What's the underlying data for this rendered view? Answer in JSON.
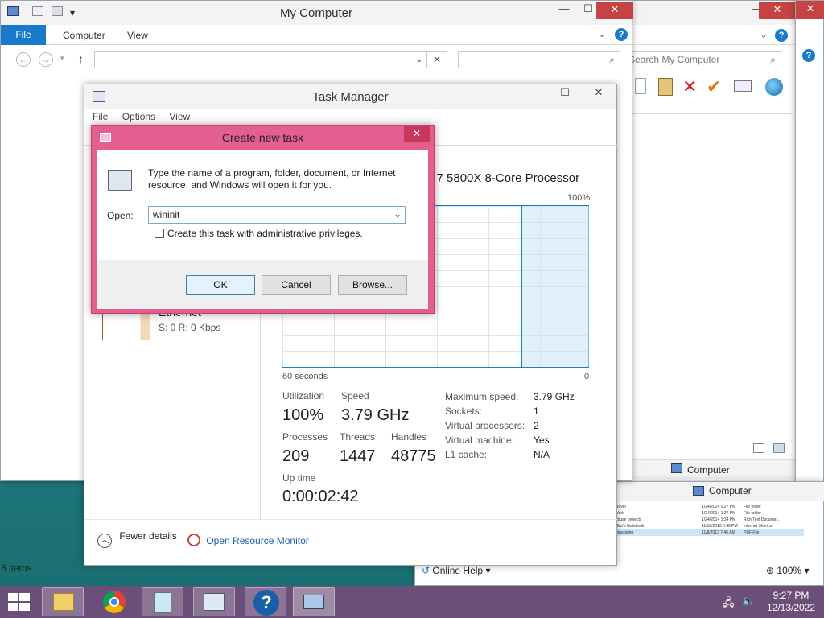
{
  "explorer": {
    "title": "My Computer",
    "tabs": [
      "File",
      "Computer",
      "View"
    ],
    "search_placeholder": "",
    "status_items": "8 items"
  },
  "explorer_back": {
    "search_placeholder": "Search My Computer",
    "status_left": "Computer",
    "status_left2": "Computer",
    "help_label": "Online Help",
    "zoom": "100%"
  },
  "file_list": {
    "rows": [
      {
        "name": "Travel",
        "date": "1/24/2014 1:27 PM",
        "type": "File folder"
      },
      {
        "name": "Work",
        "date": "1/24/2014 1:27 PM",
        "type": "File folder"
      },
      {
        "name": "House projects",
        "date": "1/24/2014 1:34 PM",
        "type": "Rich Text Docume..."
      },
      {
        "name": "Mitzi's Notebook",
        "date": "11/18/2013 5:46 PM",
        "type": "Internet Shortcut"
      },
      {
        "name": "Newsletter",
        "date": "11/8/2013 7:46 AM",
        "type": "PDF File"
      }
    ]
  },
  "task_manager": {
    "title": "Task Manager",
    "menu": [
      "File",
      "Options",
      "View"
    ],
    "processor": "n 7 5800X 8-Core Processor",
    "graph_max": "100%",
    "graph_left": "60 seconds",
    "graph_right": "0",
    "ethernet_label": "Ethernet",
    "ethernet_value": "S: 0 R: 0 Kbps",
    "utilization_label": "Utilization",
    "utilization": "100%",
    "speed_label": "Speed",
    "speed": "3.79 GHz",
    "processes_label": "Processes",
    "processes": "209",
    "threads_label": "Threads",
    "threads": "1447",
    "handles_label": "Handles",
    "handles": "48775",
    "uptime_label": "Up time",
    "uptime": "0:00:02:42",
    "details": [
      {
        "k": "Maximum speed:",
        "v": "3.79 GHz"
      },
      {
        "k": "Sockets:",
        "v": "1"
      },
      {
        "k": "Virtual processors:",
        "v": "2"
      },
      {
        "k": "Virtual machine:",
        "v": "Yes"
      },
      {
        "k": "L1 cache:",
        "v": "N/A"
      }
    ],
    "fewer_details": "Fewer details",
    "resource_monitor": "Open Resource Monitor"
  },
  "dialog": {
    "title": "Create new task",
    "description": "Type the name of a program, folder, document, or Internet resource, and Windows will open it for you.",
    "open_label": "Open:",
    "open_value": "wininit",
    "admin_label": "Create this task with administrative privileges.",
    "ok": "OK",
    "cancel": "Cancel",
    "browse": "Browse..."
  },
  "taskbar": {
    "time": "9:27 PM",
    "date": "12/13/2022"
  },
  "colors": {
    "accent_blue": "#1979ca",
    "dialog_pink": "#e45f8f",
    "taskbar": "#6b4f78"
  }
}
